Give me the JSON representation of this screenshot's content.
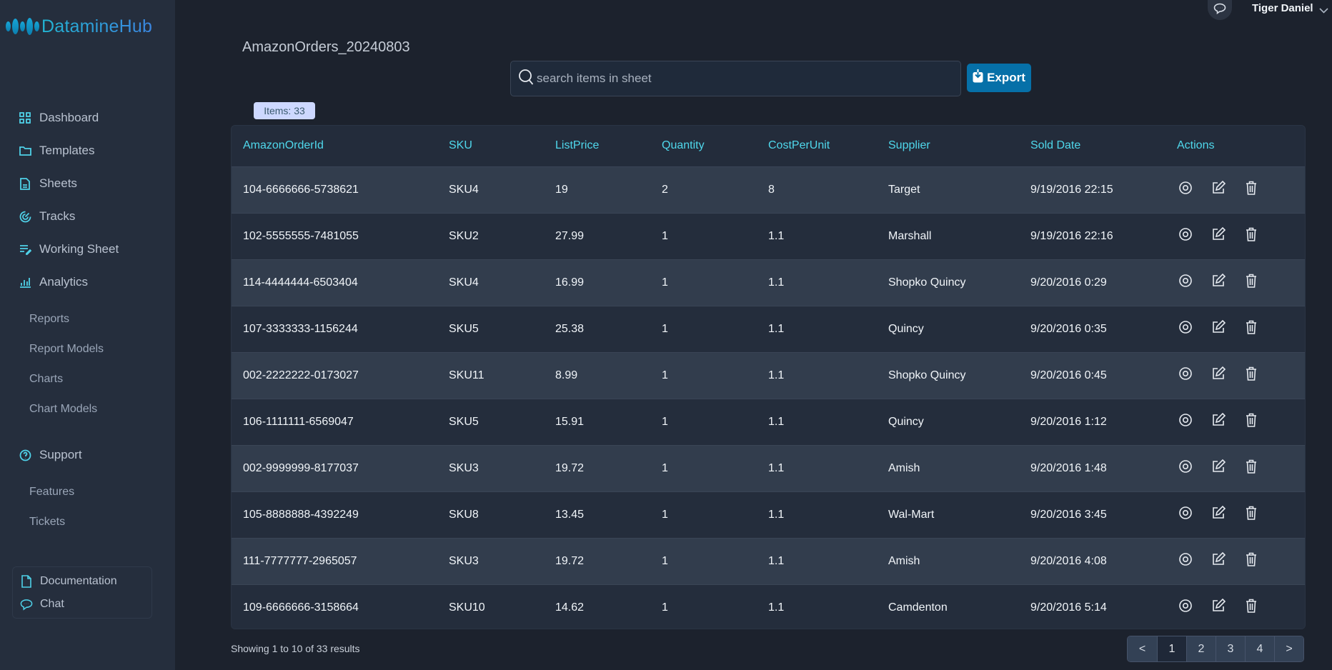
{
  "app": {
    "name": "DatamineHub"
  },
  "topbar": {
    "user_name": "Tiger Daniel",
    "chat_icon": "chat-bubble-icon",
    "chevron_icon": "chevron-down-icon"
  },
  "sidebar": {
    "items": [
      {
        "label": "Dashboard",
        "icon": "grid-icon"
      },
      {
        "label": "Templates",
        "icon": "folder-icon"
      },
      {
        "label": "Sheets",
        "icon": "document-icon"
      },
      {
        "label": "Tracks",
        "icon": "tracks-icon"
      },
      {
        "label": "Working Sheet",
        "icon": "list-edit-icon"
      },
      {
        "label": "Analytics",
        "icon": "bar-chart-icon"
      }
    ],
    "analytics_sub": [
      "Reports",
      "Report Models",
      "Charts",
      "Chart Models"
    ],
    "support": {
      "label": "Support",
      "icon": "help-circle-icon"
    },
    "support_sub": [
      "Features",
      "Tickets"
    ],
    "help": [
      {
        "label": "Documentation",
        "icon": "file-icon"
      },
      {
        "label": "Chat",
        "icon": "chat-icon"
      }
    ]
  },
  "main": {
    "title": "AmazonOrders_20240803",
    "search": {
      "placeholder": "search items in sheet",
      "value": ""
    },
    "export_label": "Export",
    "items_badge": "Items: 33",
    "table": {
      "columns": [
        "AmazonOrderId",
        "SKU",
        "ListPrice",
        "Quantity",
        "CostPerUnit",
        "Supplier",
        "Sold Date",
        "Actions"
      ],
      "rows": [
        [
          "104-6666666-5738621",
          "SKU4",
          "19",
          "2",
          "8",
          "Target",
          "9/19/2016 22:15"
        ],
        [
          "102-5555555-7481055",
          "SKU2",
          "27.99",
          "1",
          "1.1",
          "Marshall",
          "9/19/2016 22:16"
        ],
        [
          "114-4444444-6503404",
          "SKU4",
          "16.99",
          "1",
          "1.1",
          "Shopko Quincy",
          "9/20/2016 0:29"
        ],
        [
          "107-3333333-1156244",
          "SKU5",
          "25.38",
          "1",
          "1.1",
          "Quincy",
          "9/20/2016 0:35"
        ],
        [
          "002-2222222-0173027",
          "SKU11",
          "8.99",
          "1",
          "1.1",
          "Shopko Quincy",
          "9/20/2016 0:45"
        ],
        [
          "106-1111111-6569047",
          "SKU5",
          "15.91",
          "1",
          "1.1",
          "Quincy",
          "9/20/2016 1:12"
        ],
        [
          "002-9999999-8177037",
          "SKU3",
          "19.72",
          "1",
          "1.1",
          "Amish",
          "9/20/2016 1:48"
        ],
        [
          "105-8888888-4392249",
          "SKU8",
          "13.45",
          "1",
          "1.1",
          "Wal-Mart",
          "9/20/2016 3:45"
        ],
        [
          "111-7777777-2965057",
          "SKU3",
          "19.72",
          "1",
          "1.1",
          "Amish",
          "9/20/2016 4:08"
        ],
        [
          "109-6666666-3158664",
          "SKU10",
          "14.62",
          "1",
          "1.1",
          "Camdenton",
          "9/20/2016 5:14"
        ]
      ],
      "row_actions": [
        "view-icon",
        "edit-icon",
        "delete-icon"
      ]
    },
    "showing_text": "Showing 1 to 10 of 33 results",
    "pagination": {
      "prev": "<",
      "pages": [
        "1",
        "2",
        "3",
        "4"
      ],
      "current": "1",
      "next": ">"
    }
  },
  "colors": {
    "accent": "#4fd8ec",
    "export_button": "#0670a8",
    "badge_bg": "#cdd8ff"
  }
}
